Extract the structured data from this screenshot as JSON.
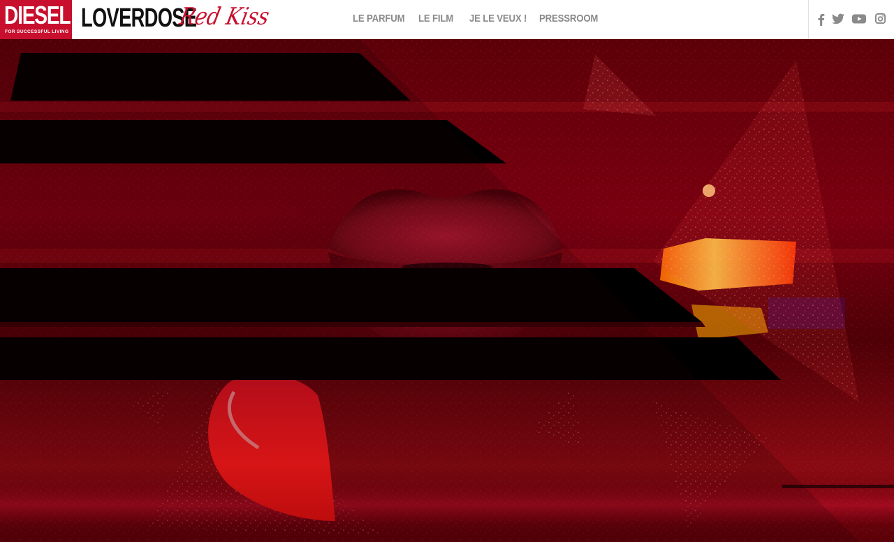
{
  "brand": {
    "name": "DIESEL",
    "tagline": "FOR SUCCESSFUL LIVING",
    "color": "#c8102e"
  },
  "product": {
    "name": "LOVERDOSE",
    "subline": "Red Kiss"
  },
  "nav": {
    "items": [
      {
        "label": "LE PARFUM"
      },
      {
        "label": "LE FILM"
      },
      {
        "label": "JE LE VEUX !"
      },
      {
        "label": "PRESSROOM"
      }
    ],
    "color": "#8a8a8a"
  },
  "social": {
    "icons": [
      "facebook-icon",
      "twitter-icon",
      "youtube-icon",
      "instagram-icon"
    ],
    "color": "#8a8a8a"
  },
  "hero": {
    "subject": "red lips video still",
    "palette": [
      "#5c0008",
      "#c8102e",
      "#ff2020",
      "#ffb000",
      "#000000"
    ]
  }
}
